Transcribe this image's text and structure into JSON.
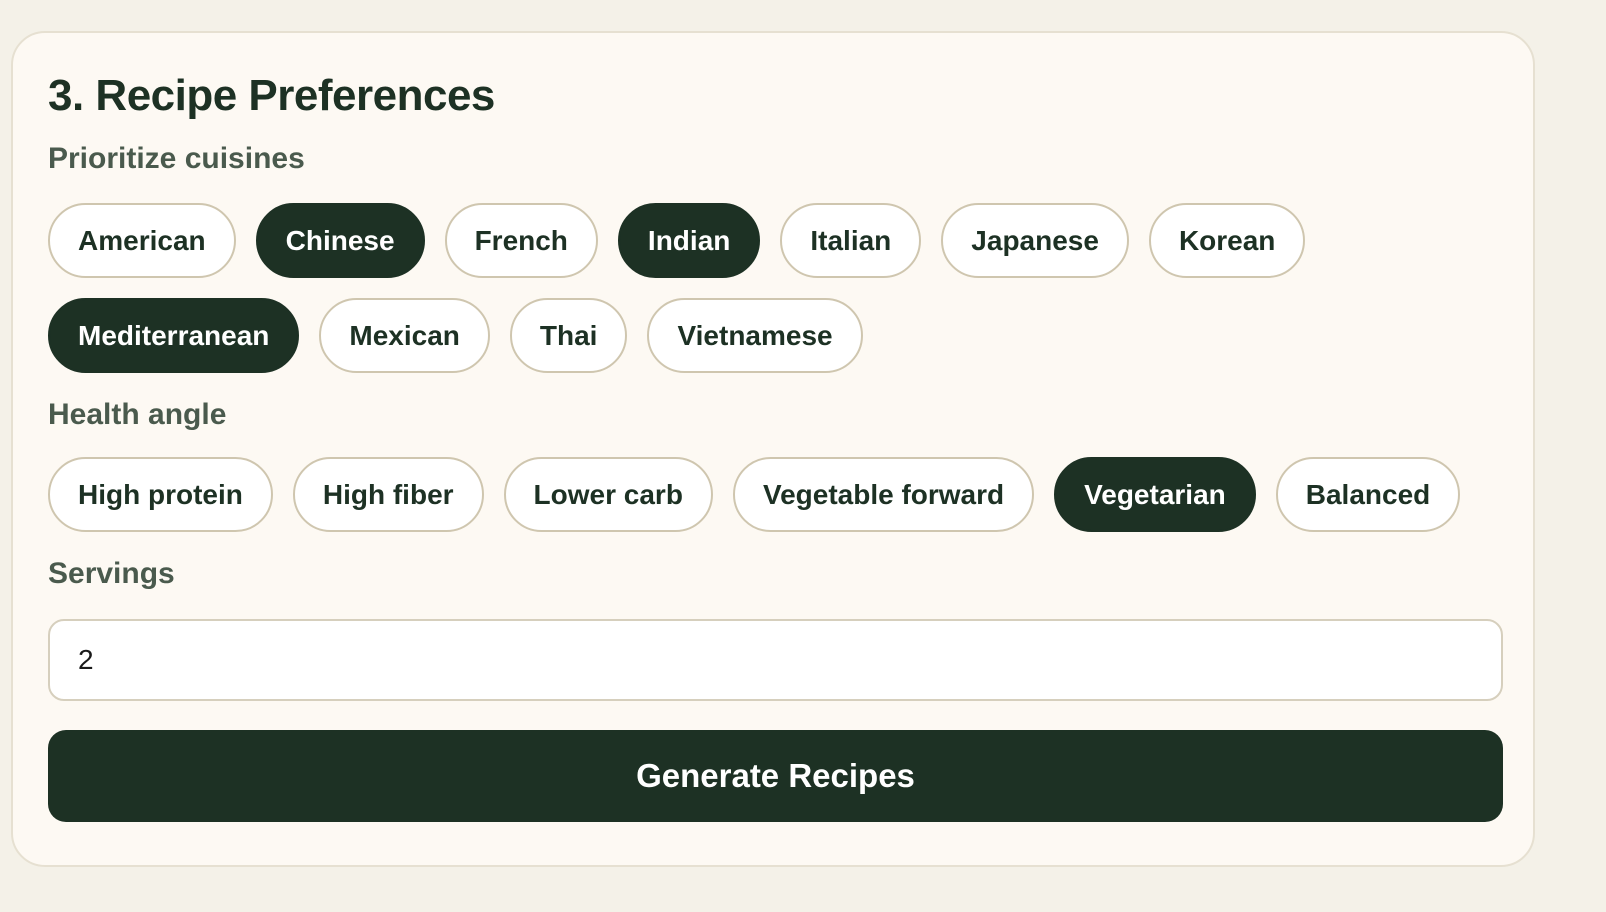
{
  "section": {
    "title": "3. Recipe Preferences"
  },
  "cuisines": {
    "label": "Prioritize cuisines",
    "options": [
      {
        "label": "American",
        "selected": false
      },
      {
        "label": "Chinese",
        "selected": true
      },
      {
        "label": "French",
        "selected": false
      },
      {
        "label": "Indian",
        "selected": true
      },
      {
        "label": "Italian",
        "selected": false
      },
      {
        "label": "Japanese",
        "selected": false
      },
      {
        "label": "Korean",
        "selected": false
      },
      {
        "label": "Mediterranean",
        "selected": true
      },
      {
        "label": "Mexican",
        "selected": false
      },
      {
        "label": "Thai",
        "selected": false
      },
      {
        "label": "Vietnamese",
        "selected": false
      }
    ]
  },
  "health": {
    "label": "Health angle",
    "options": [
      {
        "label": "High protein",
        "selected": false
      },
      {
        "label": "High fiber",
        "selected": false
      },
      {
        "label": "Lower carb",
        "selected": false
      },
      {
        "label": "Vegetable forward",
        "selected": false
      },
      {
        "label": "Vegetarian",
        "selected": true
      },
      {
        "label": "Balanced",
        "selected": false
      }
    ]
  },
  "servings": {
    "label": "Servings",
    "value": "2"
  },
  "actions": {
    "generate_label": "Generate Recipes"
  },
  "colors": {
    "page_background": "#f4f1e8",
    "card_background": "#fdf9f3",
    "accent_dark_green": "#1d3124",
    "chip_border": "#cfc6af",
    "label_text": "#4a5a4d"
  }
}
